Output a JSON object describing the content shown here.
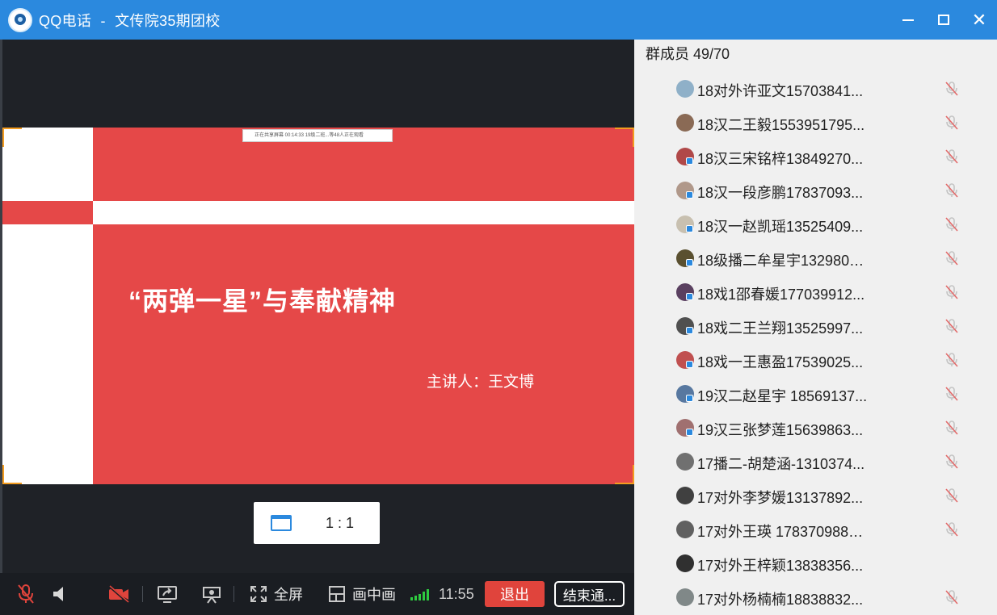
{
  "window": {
    "app_name": "QQ电话",
    "separator": "-",
    "group_name": "文传院35期团校"
  },
  "slide": {
    "header_bar_text": "正在共享屏幕   00:14:33   19级二班...等48人正在观看",
    "title": "“两弹一星”与奉献精神",
    "speaker": "主讲人：王文博",
    "background_color": "#e54848"
  },
  "ratio_button": {
    "label": "1 : 1"
  },
  "toolbar": {
    "fullscreen_label": "全屏",
    "pip_label": "画中画",
    "time": "11:55",
    "exit_label": "退出",
    "end_call_label": "结束通..."
  },
  "members": {
    "header": "群成员 49/70",
    "list": [
      {
        "name": "18对外许亚文15703841...",
        "avatar_color": "#8fb0c8",
        "badge": false
      },
      {
        "name": "18汉二王毅1553951795...",
        "avatar_color": "#8a6a55",
        "badge": false
      },
      {
        "name": "18汉三宋铭梓13849270...",
        "avatar_color": "#b04848",
        "badge": true
      },
      {
        "name": "18汉一段彦鹏17837093...",
        "avatar_color": "#b0988a",
        "badge": true
      },
      {
        "name": "18汉一赵凯瑶13525409...",
        "avatar_color": "#c8c0b0",
        "badge": true
      },
      {
        "name": "18级播二牟星宇1329801...",
        "avatar_color": "#5a5030",
        "badge": true
      },
      {
        "name": "18戏1邵春媛177039912...",
        "avatar_color": "#5a4060",
        "badge": true
      },
      {
        "name": "18戏二王兰翔13525997...",
        "avatar_color": "#505050",
        "badge": true
      },
      {
        "name": "18戏一王惠盈17539025...",
        "avatar_color": "#c05050",
        "badge": true
      },
      {
        "name": "19汉二赵星宇 18569137...",
        "avatar_color": "#5878a0",
        "badge": true
      },
      {
        "name": "19汉三张梦莲15639863...",
        "avatar_color": "#a07070",
        "badge": true
      },
      {
        "name": "17播二-胡楚涵-1310374...",
        "avatar_color": "#707070",
        "badge": false
      },
      {
        "name": "17对外李梦媛13137892...",
        "avatar_color": "#404040",
        "badge": false
      },
      {
        "name": "17对外王瑛 1783709882...",
        "avatar_color": "#606060",
        "badge": false
      },
      {
        "name": "17对外王梓颖13838356...",
        "avatar_color": "#303030",
        "badge": false
      },
      {
        "name": "17对外杨楠楠18838832...",
        "avatar_color": "#808888",
        "badge": false
      }
    ],
    "muted_rows": [
      true,
      true,
      true,
      true,
      true,
      true,
      true,
      true,
      true,
      true,
      true,
      true,
      true,
      true,
      false,
      true
    ]
  }
}
